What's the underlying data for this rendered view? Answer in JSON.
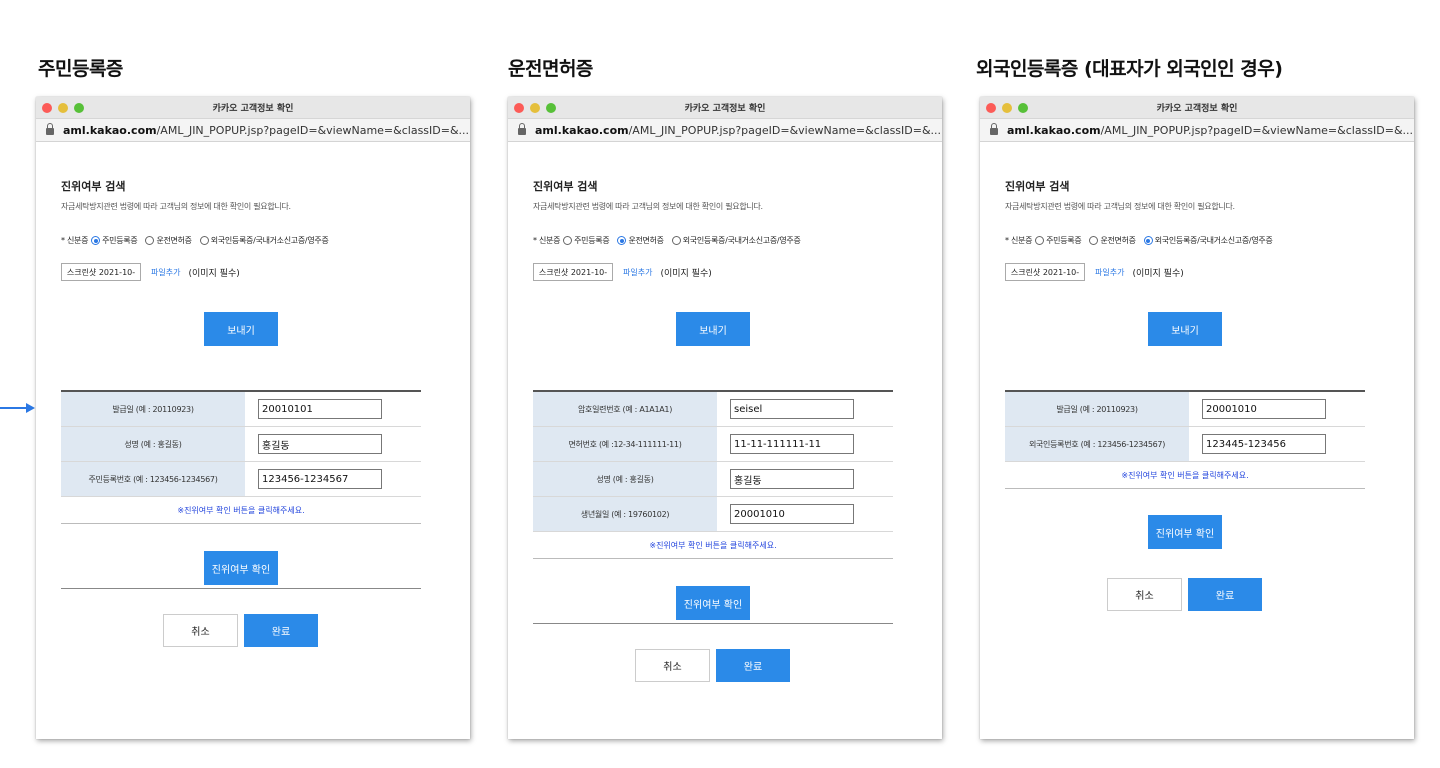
{
  "columns": [
    {
      "title": "주민등록증"
    },
    {
      "title": "운전면허증"
    },
    {
      "title": "외국인등록증 (대표자가 외국인인 경우)"
    }
  ],
  "window": {
    "title": "카카오 고객정보 확인",
    "url_domain": "aml.kakao.com",
    "url_path": "/AML_JIN_POPUP.jsp?pageID=&viewName=&classID=&..."
  },
  "search": {
    "heading": "진위여부 검색",
    "description": "자금세탁방지관련 법령에 따라 고객님의 정보에 대한 확인이 필요합니다."
  },
  "id_type": {
    "label": "* 신분증",
    "options": [
      "주민등록증",
      "운전면허증",
      "외국인등록증/국내거소신고증/영주증"
    ]
  },
  "file": {
    "name": "스크린샷 2021-10-",
    "add_label": "파일추가",
    "required_note": "(이미지 필수)"
  },
  "buttons": {
    "send": "보내기",
    "verify": "진위여부 확인",
    "cancel": "취소",
    "done": "완료"
  },
  "notice": "※진위여부 확인 버튼을 클릭해주세요.",
  "forms": [
    {
      "selected": 0,
      "rows": [
        {
          "label": "발급일 (예 : 20110923)",
          "value": "20010101"
        },
        {
          "label": "성명 (예 : 홍길동)",
          "value": "홍길동"
        },
        {
          "label": "주민등록번호 (예 : 123456-1234567)",
          "value": "123456-1234567"
        }
      ]
    },
    {
      "selected": 1,
      "rows": [
        {
          "label": "암호일련번호 (예 : A1A1A1)",
          "value": "seisel"
        },
        {
          "label": "면허번호 (예 :12-34-111111-11)",
          "value": "11-11-111111-11"
        },
        {
          "label": "성명 (예 : 홍길동)",
          "value": "홍길동"
        },
        {
          "label": "생년월일 (예 : 19760102)",
          "value": "20001010"
        }
      ]
    },
    {
      "selected": 2,
      "rows": [
        {
          "label": "발급일 (예 : 20110923)",
          "value": "20001010"
        },
        {
          "label": "외국인등록번호 (예 : 123456-1234567)",
          "value": "123445-123456"
        }
      ]
    }
  ],
  "colors": {
    "accent": "#2b8ae8",
    "label_bg": "#dfe8f2",
    "notice": "#2244dd",
    "arrow": "#2b78e4"
  }
}
